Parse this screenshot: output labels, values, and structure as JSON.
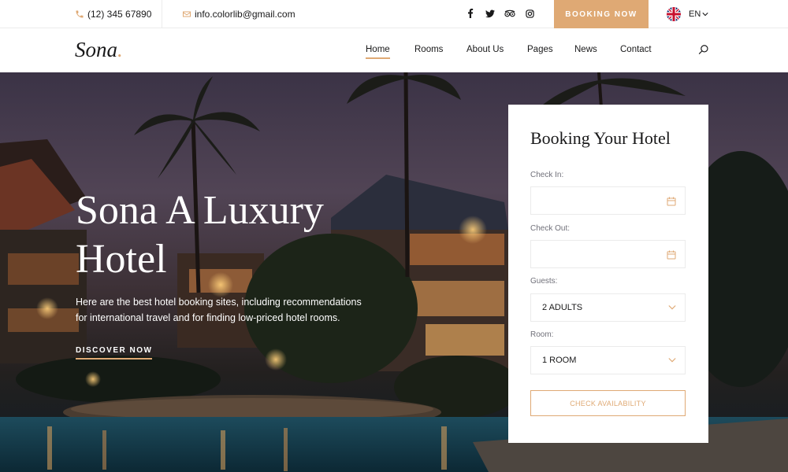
{
  "topbar": {
    "phone": "(12) 345 67890",
    "phone_icon": "phone-icon",
    "email": "info.colorlib@gmail.com",
    "email_icon": "mail-icon",
    "socials": [
      "facebook-icon",
      "twitter-icon",
      "tripadvisor-icon",
      "instagram-icon"
    ],
    "booking_label": "BOOKING NOW",
    "language": "EN"
  },
  "nav": {
    "logo": "Sona",
    "logo_dot": ".",
    "items": [
      {
        "label": "Home",
        "active": true
      },
      {
        "label": "Rooms"
      },
      {
        "label": "About Us"
      },
      {
        "label": "Pages"
      },
      {
        "label": "News"
      },
      {
        "label": "Contact"
      }
    ]
  },
  "hero": {
    "title": "Sona A Luxury Hotel",
    "text": "Here are the best hotel booking sites, including recommendations for international travel and for finding low-priced hotel rooms.",
    "cta": "DISCOVER NOW"
  },
  "booking": {
    "title": "Booking Your Hotel",
    "check_in_label": "Check In:",
    "check_in_value": "",
    "check_out_label": "Check Out:",
    "check_out_value": "",
    "guests_label": "Guests:",
    "guests_value": "2 ADULTS",
    "room_label": "Room:",
    "room_value": "1 ROOM",
    "submit_label": "CHECK AVAILABILITY"
  },
  "colors": {
    "accent": "#dfa974",
    "text": "#19191a",
    "muted": "#707079",
    "border": "#ebebeb"
  }
}
